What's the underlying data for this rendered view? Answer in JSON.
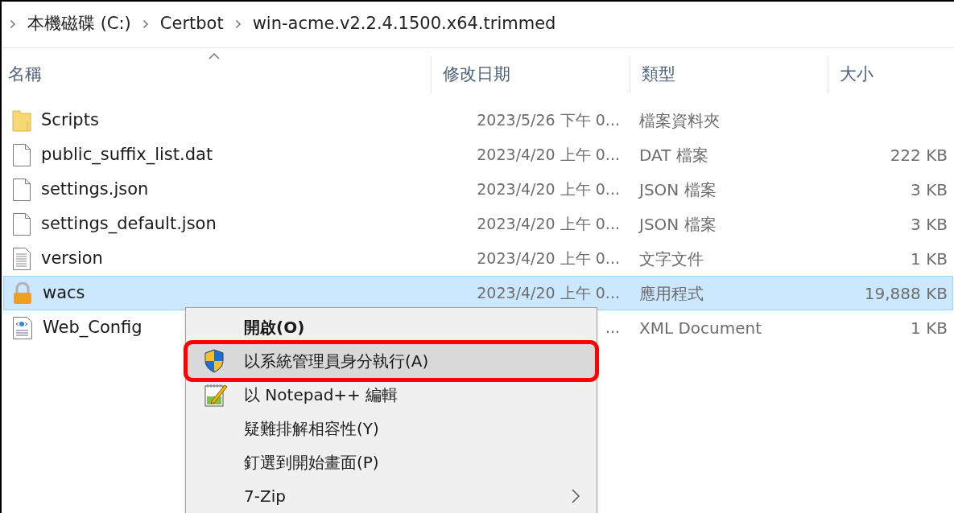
{
  "breadcrumb": [
    "本機磁碟 (C:)",
    "Certbot",
    "win-acme.v2.2.4.1500.x64.trimmed"
  ],
  "columns": [
    "名稱",
    "修改日期",
    "類型",
    "大小"
  ],
  "files": [
    {
      "kind": "folder",
      "name": "Scripts",
      "date": "2023/5/26 下午 0...",
      "type": "檔案資料夾",
      "selected": false
    },
    {
      "kind": "blank",
      "name": "public_suffix_list.dat",
      "date": "2023/4/20 上午 0...",
      "type": "DAT 檔案",
      "size": "222 KB",
      "selected": false
    },
    {
      "kind": "blank",
      "name": "settings.json",
      "date": "2023/4/20 上午 0...",
      "type": "JSON 檔案",
      "size": "3 KB",
      "selected": false
    },
    {
      "kind": "blank",
      "name": "settings_default.json",
      "date": "2023/4/20 上午 0...",
      "type": "JSON 檔案",
      "size": "3 KB",
      "selected": false
    },
    {
      "kind": "text",
      "name": "version",
      "date": "2023/4/20 上午 0...",
      "type": "文字文件",
      "size": "1 KB",
      "selected": false
    },
    {
      "kind": "app",
      "name": "wacs",
      "date": "2023/4/20 上午 0...",
      "type": "應用程式",
      "size": "19,888 KB",
      "selected": true
    },
    {
      "kind": "xml",
      "name": "Web_Config",
      "date": "...",
      "type": "XML Document",
      "size": "1 KB",
      "selected": false
    }
  ],
  "context_menu": [
    {
      "kind": "plain",
      "label": "開啟(O)",
      "bold": true,
      "highlighted": false,
      "submenu": false
    },
    {
      "kind": "shield",
      "label": "以系統管理員身分執行(A)",
      "bold": false,
      "highlighted": true,
      "submenu": false
    },
    {
      "kind": "notepad",
      "label": "以 Notepad++ 編輯",
      "bold": false,
      "highlighted": false,
      "submenu": false
    },
    {
      "kind": "plain",
      "label": "疑難排解相容性(Y)",
      "bold": false,
      "highlighted": false,
      "submenu": false
    },
    {
      "kind": "plain",
      "label": "釘選到開始畫面(P)",
      "bold": false,
      "highlighted": false,
      "submenu": false
    },
    {
      "kind": "plain",
      "label": "7-Zip",
      "bold": false,
      "highlighted": false,
      "submenu": true
    }
  ]
}
